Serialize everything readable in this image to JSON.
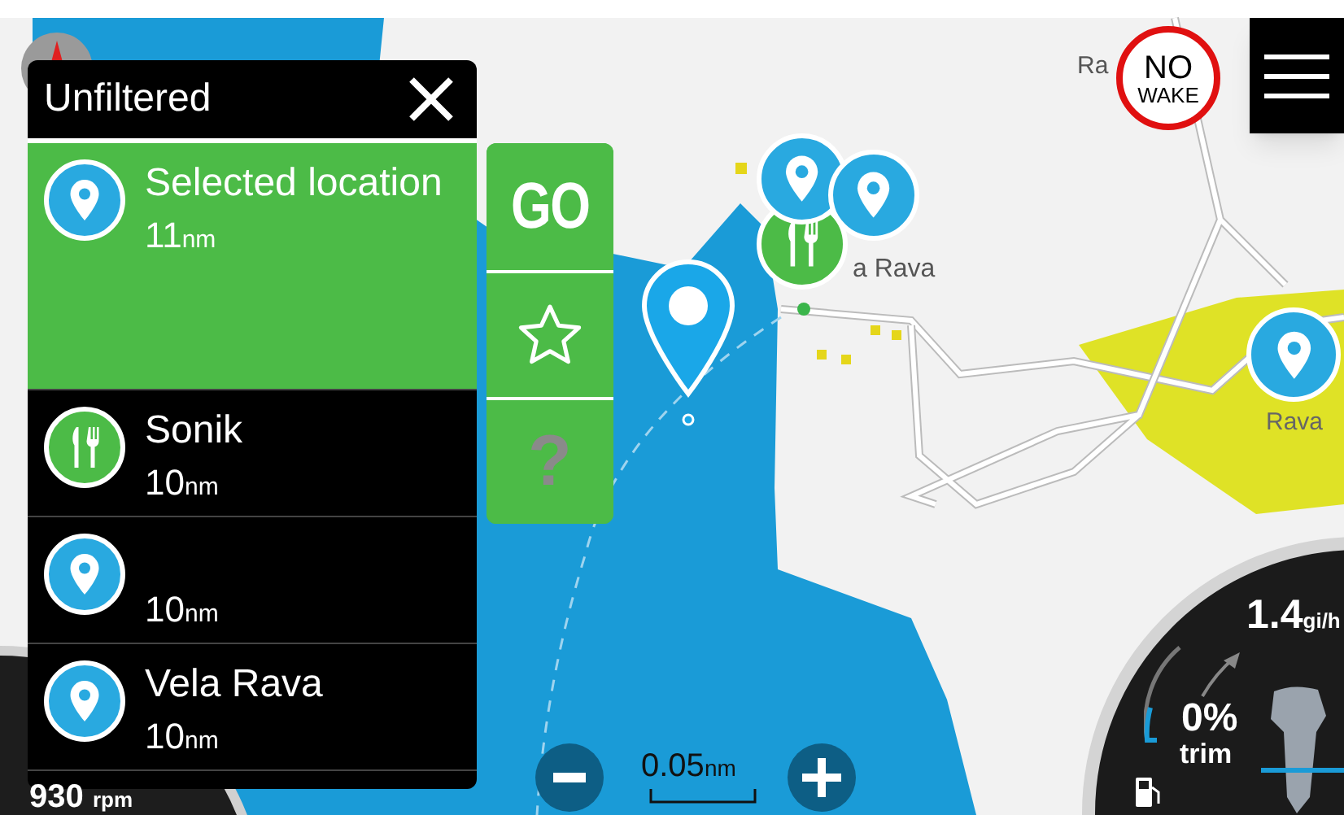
{
  "panel": {
    "title": "Unfiltered",
    "locations": [
      {
        "kind": "pin",
        "name": "Selected location",
        "distance": "11",
        "unit": "nm",
        "selected": true
      },
      {
        "kind": "food",
        "name": "Sonik",
        "distance": "10",
        "unit": "nm",
        "selected": false
      },
      {
        "kind": "pin",
        "distance": "10",
        "unit": "nm",
        "selected": false
      },
      {
        "kind": "pin",
        "name": "Vela Rava",
        "distance": "10",
        "unit": "nm",
        "selected": false
      }
    ]
  },
  "actions": [
    {
      "kind": "go",
      "label": "GO"
    },
    {
      "kind": "favorite"
    },
    {
      "kind": "help",
      "label": "?"
    }
  ],
  "map": {
    "labels": [
      "Ra",
      "a Rava",
      "Rava"
    ],
    "no_wake": {
      "line_1": "NO",
      "line_2": "WAKE"
    },
    "scale": {
      "value": "0.05",
      "unit": "nm"
    }
  },
  "gauge": {
    "fuel_rate": "1.4",
    "fuel_unit": "gi/h",
    "trim": "0%",
    "trim_label": "trim"
  },
  "left_gauge": {
    "rpm": "930",
    "rpm_unit": "rpm"
  }
}
